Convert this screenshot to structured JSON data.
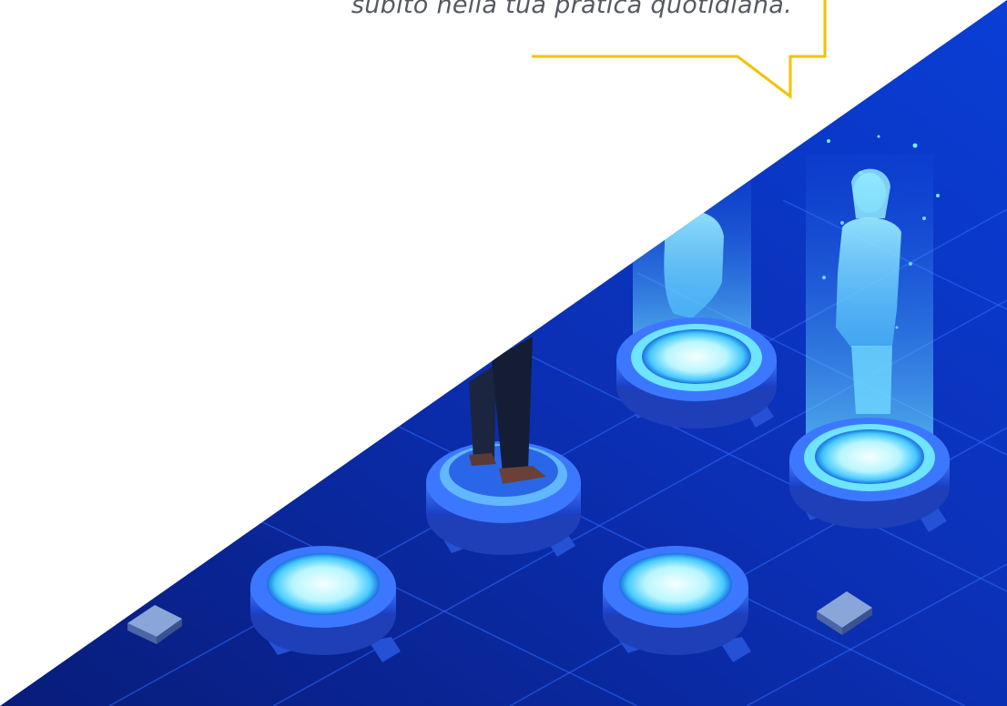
{
  "callout": {
    "text": "subito nella tua pratica quotidiana.",
    "border_color": "#f2c300",
    "text_color": "#555a61"
  },
  "illustration": {
    "background_color": "#0a2fb0",
    "glow_color": "#7fe9ff"
  }
}
